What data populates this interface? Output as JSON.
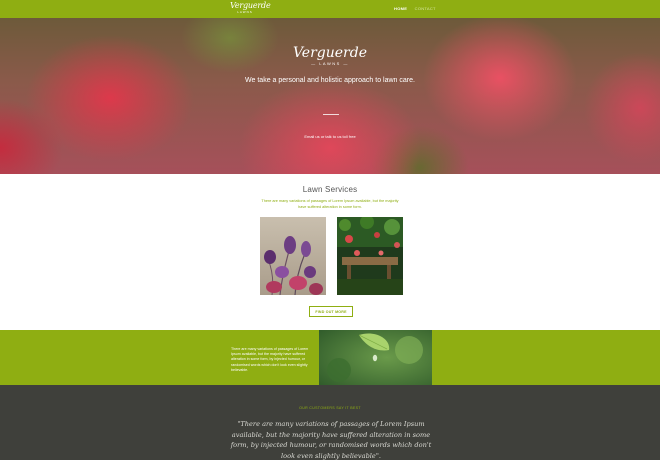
{
  "nav": {
    "logo_script": "Verguerde",
    "logo_sub": "LAWNS",
    "items": [
      {
        "label": "HOME",
        "active": true
      },
      {
        "label": "CONTACT",
        "active": false
      }
    ]
  },
  "hero": {
    "logo_script": "Verguerde",
    "logo_sub": "— LAWNS —",
    "tagline": "We take a personal and holistic approach to lawn care.",
    "cta": "Email us or talk to us toll free"
  },
  "services": {
    "title": "Lawn Services",
    "description": "There are many variations of passages of Lorem Ipsum available, but the majority have suffered alteration in some form.",
    "button_label": "FIND OUT MORE"
  },
  "band": {
    "text": "There are many variations of passages of Lorem Ipsum available, but the majority have suffered alteration in some form, by injected humour, or randomised words which don't look even slightly believable."
  },
  "testimonials": {
    "label": "OUR CUSTOMERS SAY IT BEST",
    "quote": "\"There are many variations of passages of Lorem Ipsum available, but the majority have suffered alteration in some form, by injected humour, or randomised words which don't look even slightly believable\"."
  },
  "colors": {
    "accent_green": "#8fae12",
    "dark_band": "#3f403b",
    "white": "#ffffff"
  }
}
